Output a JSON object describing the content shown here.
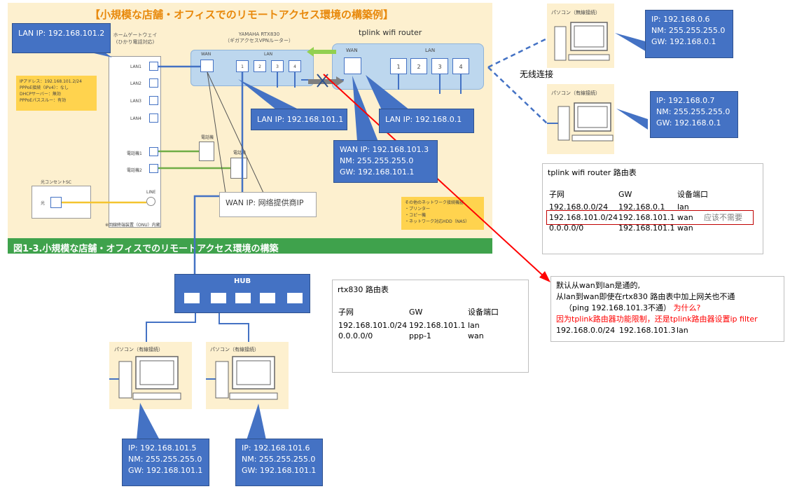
{
  "panel": {
    "title": "【小規模な店舗・オフィスでのリモートアクセス環境の構築例】",
    "footer": "図1-3.小規模な店舗・オフィスでのリモートアクセス環境の構築",
    "gateway_title_1": "ホームゲートウェイ",
    "gateway_title_2": "(ひかり電話対応)",
    "gateway_ports": [
      "LAN1",
      "LAN2",
      "LAN3",
      "LAN4"
    ],
    "gateway_tel_ports": [
      "電話機1",
      "電話機2"
    ],
    "gateway_line": "LINE",
    "gateway_note": "※回線終端装置（ONU）内蔵",
    "gateway_info": [
      "IPアドレス：192.168.101.2/24",
      "PPPoE接続（IPv4）：なし",
      "DHCPサーバー：無効",
      "PPPoEパススルー：有効"
    ],
    "onu_title": "光コンセントSC",
    "onu_port": "光",
    "phone1": "電話機",
    "phone2": "電話機",
    "yamaha_title_1": "YAMAHA RTX830",
    "yamaha_title_2": "（ギガアクセスVPNルーター）",
    "yamaha_wan": "WAN",
    "yamaha_lan": "LAN",
    "yamaha_ports": [
      "1",
      "2",
      "3",
      "4"
    ],
    "other_devices": [
      "その他のネットワーク接続機器",
      "・プリンター",
      "・コピー機",
      "・ネットワーク対応HDD（NAS）"
    ]
  },
  "tplink": {
    "title": "tplink wifi router",
    "wan": "WAN",
    "lan": "LAN",
    "ports": [
      "1",
      "2",
      "3",
      "4"
    ]
  },
  "wireless_label": "无线连接",
  "pcs": {
    "wireless_title": "パソコン（無線接続）",
    "wired_title": "パソコン（有線接続）"
  },
  "callouts": {
    "gateway_lan_ip": "LAN IP: 192.168.101.2",
    "rtx_lan_ip": "LAN IP: 192.168.101.1",
    "tplink_lan_ip": "LAN IP: 192.168.0.1",
    "tplink_wan": "WAN IP: 192.168.101.3\nNM: 255.255.255.0\nGW: 192.168.101.1",
    "rtx_wan_ip": "WAN IP: 网络提供商IP",
    "pc_wireless": "IP: 192.168.0.6\nNM: 255.255.255.0\nGW: 192.168.0.1",
    "pc_wired_right": "IP: 192.168.0.7\nNM: 255.255.255.0\nGW: 192.168.0.1",
    "pc_left": "IP: 192.168.101.5\nNM: 255.255.255.0\nGW: 192.168.101.1",
    "pc_mid": "IP: 192.168.101.6\nNM: 255.255.255.0\nGW: 192.168.101.1"
  },
  "hub": {
    "title": "HUB"
  },
  "tplink_table": {
    "title": "tplink wifi router 路由表",
    "headers": [
      "子网",
      "GW",
      "设备端口"
    ],
    "rows": [
      [
        "192.168.0.0/24",
        "192.168.0.1",
        "lan"
      ],
      [
        "192.168.101.0/24",
        "192.168.101.1",
        "wan"
      ],
      [
        "0.0.0.0/0",
        "192.168.101.1",
        "wan"
      ]
    ],
    "note": "应该不需要"
  },
  "rtx_table": {
    "title": "rtx830 路由表",
    "headers": [
      "子网",
      "GW",
      "设备端口"
    ],
    "rows": [
      [
        "192.168.101.0/24",
        "192.168.101.1",
        "lan"
      ],
      [
        "0.0.0.0/0",
        "ppp-1",
        "wan"
      ]
    ]
  },
  "note": {
    "line1": "默认从wan到lan是通的,",
    "line2": "从lan到wan即使在rtx830 路由表中加上网关也不通",
    "line3a": "（ping 192.168.101.3不通）",
    "line3b": "为什么?",
    "line4": "因为tplink路由器功能限制，还是tplink路由器设置ip filter",
    "route": [
      "192.168.0.0/24",
      "192.168.101.3",
      "lan"
    ]
  },
  "colors": {
    "callout": "#4472c4",
    "panel": "#fdf0cf",
    "router": "#bdd7ee",
    "red": "#ff0000",
    "green": "#3fa24c"
  }
}
